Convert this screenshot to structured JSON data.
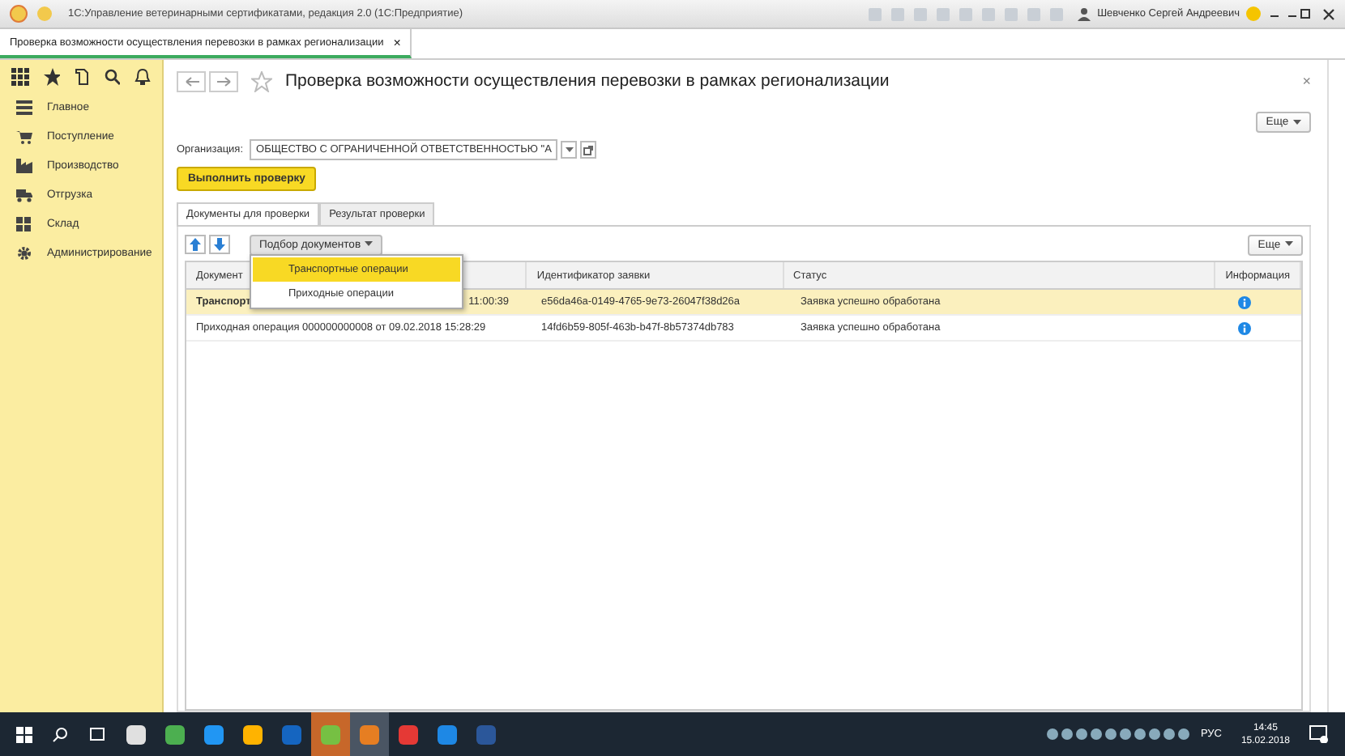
{
  "window": {
    "title": "1С:Управление ветеринарными сертификатами, редакция 2.0  (1С:Предприятие)",
    "user": "Шевченко Сергей Андреевич"
  },
  "open_tabs": [
    {
      "label": "Проверка возможности осуществления перевозки в рамках регионализации",
      "close": "×",
      "selected": true
    }
  ],
  "sidebar": {
    "items": [
      {
        "label": "Главное"
      },
      {
        "label": "Поступление"
      },
      {
        "label": "Производство"
      },
      {
        "label": "Отгрузка"
      },
      {
        "label": "Склад"
      },
      {
        "label": "Администрирование"
      }
    ]
  },
  "page": {
    "title": "Проверка возможности осуществления перевозки в рамках регионализации",
    "close": "×",
    "more": "Еще",
    "organization": {
      "label": "Организация:",
      "value": "ОБЩЕСТВО С ОГРАНИЧЕННОЙ ОТВЕТСТВЕННОСТЬЮ \"А"
    },
    "run_button": "Выполнить проверку",
    "tabs": [
      {
        "label": "Документы для проверки",
        "selected": true
      },
      {
        "label": "Результат проверки",
        "selected": false
      }
    ],
    "toolbar": {
      "picker": "Подбор документов",
      "more": "Еще"
    },
    "dropdown": [
      {
        "label": "Транспортные операции",
        "selected": true
      },
      {
        "label": "Приходные операции",
        "selected": false
      }
    ],
    "table": {
      "columns": [
        "Документ",
        "Идентификатор заявки",
        "Статус",
        "Информация"
      ],
      "rows": [
        {
          "document": "Транспорт",
          "document_end": "11:00:39",
          "id": "e56da46a-0149-4765-9e73-26047f38d26a",
          "status": "Заявка успешно обработана",
          "selected": true
        },
        {
          "document": "Приходная операция 000000000008 от 09.02.2018 15:28:29",
          "id": "14fd6b59-805f-463b-b47f-8b57374db783",
          "status": "Заявка успешно обработана",
          "selected": false
        }
      ]
    }
  },
  "taskbar": {
    "language": "РУС",
    "time": "14:45",
    "date": "15.02.2018"
  }
}
